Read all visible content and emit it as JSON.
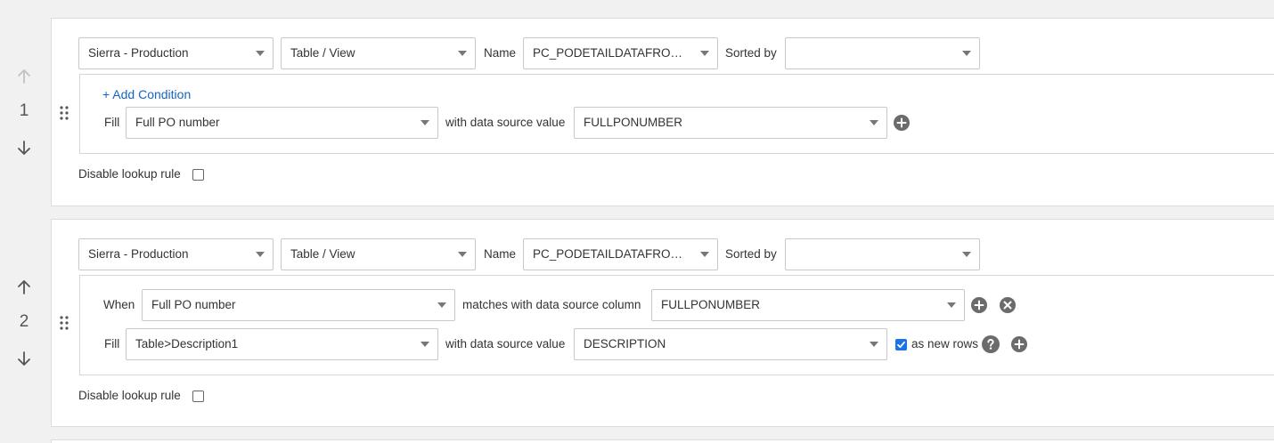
{
  "labels": {
    "name": "Name",
    "sorted_by": "Sorted by",
    "add_condition": "+ Add Condition",
    "fill": "Fill",
    "when": "When",
    "with_data_source_value": "with data source value",
    "matches_with_data_source_column": "matches with data source column",
    "as_new_rows": "as new rows",
    "disable_lookup_rule": "Disable lookup rule"
  },
  "rules": [
    {
      "number": "1",
      "up_enabled": false,
      "down_enabled": true,
      "data_source": "Sierra - Production",
      "object_type": "Table / View",
      "name_value": "PC_PODETAILDATAFROMBOOMI",
      "sorted_by": "",
      "fills": [
        {
          "field": "Full PO number",
          "source_value": "FULLPONUMBER"
        }
      ],
      "disable_lookup_rule": false
    },
    {
      "number": "2",
      "up_enabled": true,
      "down_enabled": true,
      "data_source": "Sierra - Production",
      "object_type": "Table / View",
      "name_value": "PC_PODETAILDATAFROMBOOMI",
      "sorted_by": "",
      "conditions": [
        {
          "field": "Full PO number",
          "source_column": "FULLPONUMBER"
        }
      ],
      "fills": [
        {
          "field": "Table>Description1",
          "source_value": "DESCRIPTION",
          "as_new_rows": true
        }
      ],
      "disable_lookup_rule": false
    }
  ],
  "icons": {
    "move_up": "arrow-up-icon",
    "move_down": "arrow-down-icon",
    "drag": "drag-handle-icon",
    "add": "plus-circle-icon",
    "remove": "close-circle-icon",
    "help": "help-circle-icon",
    "dropdown": "chevron-down-icon"
  },
  "colors": {
    "link": "#1565c0",
    "checkbox_checked": "#1a73e8",
    "icon_button": "#6b6b6b",
    "disabled_arrow": "#c2c2c2"
  }
}
